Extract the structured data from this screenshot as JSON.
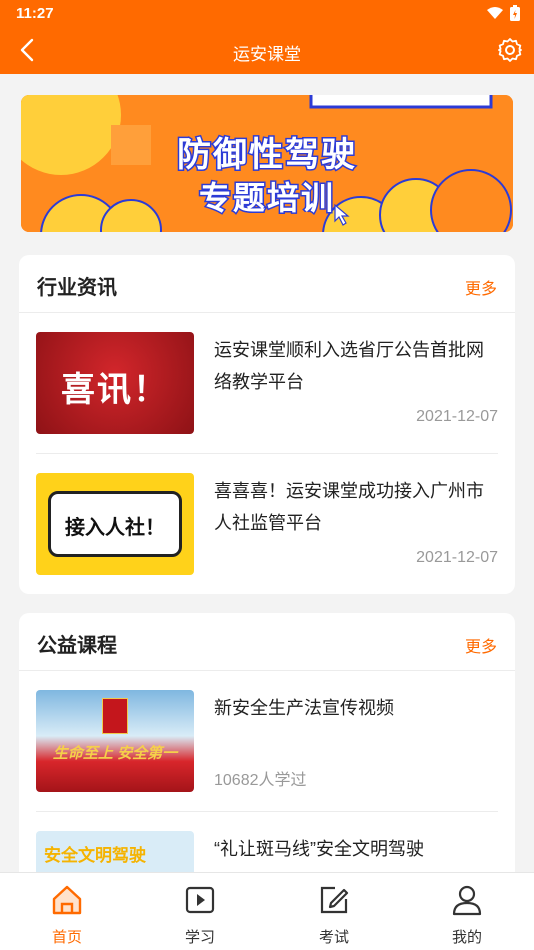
{
  "status": {
    "time": "11:27"
  },
  "appbar": {
    "title": "运安课堂"
  },
  "banner": {
    "line1": "防御性驾驶",
    "line2": "专题培训"
  },
  "news": {
    "title": "行业资讯",
    "more": "更多",
    "items": [
      {
        "title": "运安课堂顺利入选省厅公告首批网络教学平台",
        "date": "2021-12-07",
        "thumb_text": "喜讯！"
      },
      {
        "title": "喜喜喜！运安课堂成功接入广州市人社监管平台",
        "date": "2021-12-07",
        "thumb_text": "接入人社！"
      }
    ]
  },
  "courses": {
    "title": "公益课程",
    "more": "更多",
    "items": [
      {
        "title": "新安全生产法宣传视频",
        "meta": "10682人学过",
        "thumb_text": "生命至上 安全第一"
      },
      {
        "title": "“礼让斑马线”安全文明驾驶",
        "thumb_text": "安全文明驾驶"
      }
    ]
  },
  "tabs": [
    {
      "label": "首页",
      "icon": "home-icon"
    },
    {
      "label": "学习",
      "icon": "play-icon"
    },
    {
      "label": "考试",
      "icon": "edit-icon"
    },
    {
      "label": "我的",
      "icon": "user-icon"
    }
  ],
  "colors": {
    "accent": "#ff6a00"
  }
}
